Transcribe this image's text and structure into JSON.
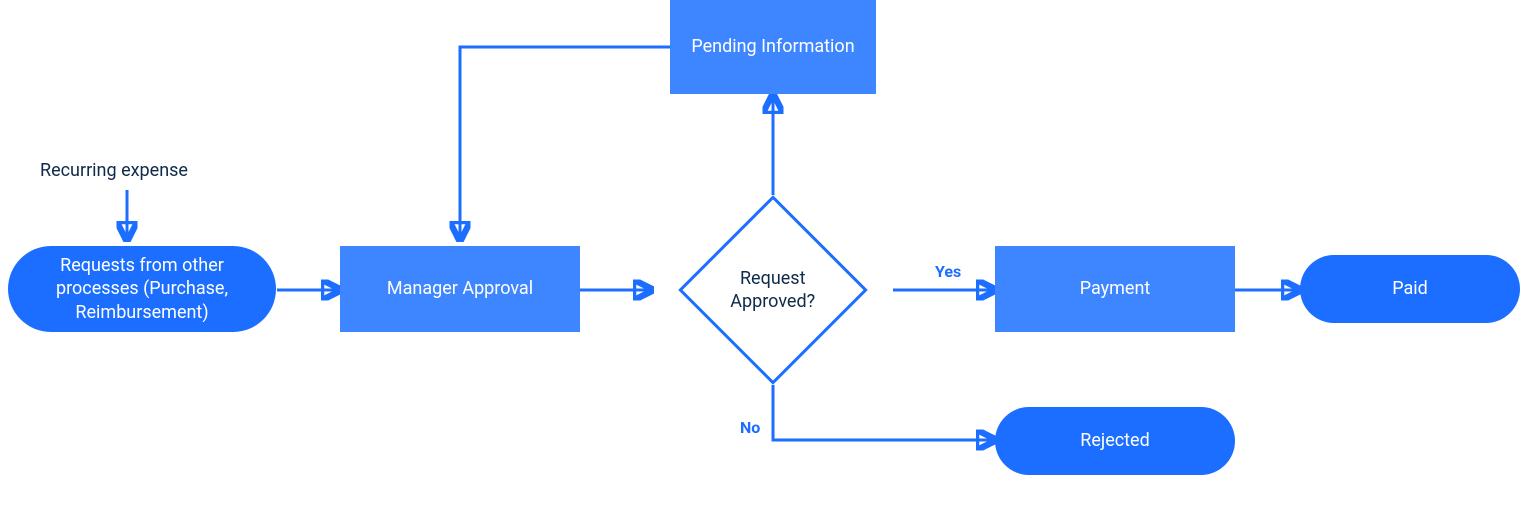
{
  "recurringExpense": {
    "label": "Recurring expense"
  },
  "nodes": {
    "requests": {
      "label": "Requests from other processes (Purchase, Reimbursement)"
    },
    "manager": {
      "label": "Manager Approval"
    },
    "decision": {
      "label": "Request Approved?"
    },
    "pending": {
      "label": "Pending Information"
    },
    "payment": {
      "label": "Payment"
    },
    "paid": {
      "label": "Paid"
    },
    "rejected": {
      "label": "Rejected"
    }
  },
  "branches": {
    "yes": "Yes",
    "no": "No"
  },
  "colors": {
    "stroke": "#1B6EFF",
    "rect": "#3D86FF",
    "pill": "#1B6EFF",
    "text": "#0F2A4A"
  }
}
